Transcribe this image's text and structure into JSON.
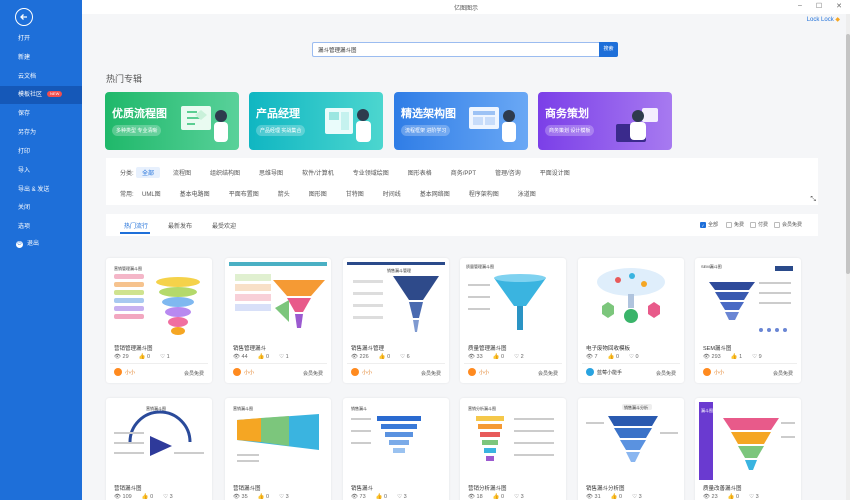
{
  "app": {
    "title": "亿图图示",
    "user": "Lock Lock"
  },
  "window": {
    "min_glyph": "–",
    "max_glyph": "☐",
    "close_glyph": "✕"
  },
  "sidebar": {
    "items": [
      {
        "label": "打开"
      },
      {
        "label": "新建"
      },
      {
        "label": "云文档"
      },
      {
        "label": "模板社区",
        "badge": "NEW",
        "active": true
      },
      {
        "label": "保存"
      },
      {
        "label": "另存为"
      },
      {
        "label": "打印"
      },
      {
        "label": "导入"
      },
      {
        "label": "导出 & 发送"
      },
      {
        "label": "关闭"
      },
      {
        "label": "选项"
      },
      {
        "label": "退出"
      }
    ]
  },
  "search": {
    "value": "漏斗管理漏斗图",
    "button": "搜索"
  },
  "section_title": "热门专辑",
  "banners": [
    {
      "title": "优质流程图",
      "subtitle": "多种类型 专业清晰"
    },
    {
      "title": "产品经理",
      "subtitle": "产品经理 实战集合"
    },
    {
      "title": "精选架构图",
      "subtitle": "流程框架 进阶学习"
    },
    {
      "title": "商务策划",
      "subtitle": "商务策划 设计模板"
    }
  ],
  "filters": {
    "category_label": "分类:",
    "categories": [
      "全部",
      "流程图",
      "组织结构图",
      "思维导图",
      "软件/计算机",
      "专业领域绘图",
      "图形表格",
      "商务/PPT",
      "管理/咨询",
      "平面设计图"
    ],
    "common_label": "常用:",
    "common": [
      "UML图",
      "基本电路图",
      "平面布置图",
      "箭头",
      "图形图",
      "甘特图",
      "时间线",
      "基本网络图",
      "程序架构图",
      "泳道图"
    ]
  },
  "tabs": [
    "热门流行",
    "最新发布",
    "最受欢迎"
  ],
  "checkboxes": [
    {
      "label": "全部",
      "checked": true
    },
    {
      "label": "免费",
      "checked": false
    },
    {
      "label": "付费",
      "checked": false
    },
    {
      "label": "会员免费",
      "checked": false
    }
  ],
  "cards": [
    {
      "title": "营销管理漏斗图",
      "views": "29",
      "likes": "0",
      "favs": "1",
      "author": "小小",
      "price": "会员免费",
      "thumb_label": "营销管理漏斗图"
    },
    {
      "title": "销售管理漏斗",
      "views": "44",
      "likes": "0",
      "favs": "1",
      "author": "小小",
      "price": "会员免费",
      "thumb_label": ""
    },
    {
      "title": "销售漏斗管理",
      "views": "226",
      "likes": "0",
      "favs": "6",
      "author": "小小",
      "price": "会员免费",
      "thumb_label": "销售漏斗管理"
    },
    {
      "title": "质量管理漏斗图",
      "views": "33",
      "likes": "0",
      "favs": "2",
      "author": "小小",
      "price": "会员免费",
      "thumb_label": "质量管理漏斗图"
    },
    {
      "title": "电子废物回收模板",
      "views": "7",
      "likes": "0",
      "favs": "0",
      "author": "蓝莓小能手",
      "price": "会员免费",
      "thumb_label": ""
    },
    {
      "title": "SEM漏斗图",
      "views": "293",
      "likes": "1",
      "favs": "9",
      "author": "小小",
      "price": "会员免费",
      "thumb_label": "SEM漏斗图"
    },
    {
      "title": "营销漏斗图",
      "views": "109",
      "likes": "0",
      "favs": "3",
      "author": "",
      "price": "",
      "thumb_label": "营销漏斗图"
    },
    {
      "title": "营销漏斗图",
      "views": "35",
      "likes": "0",
      "favs": "3",
      "author": "",
      "price": "",
      "thumb_label": "营销漏斗图"
    },
    {
      "title": "销售漏斗",
      "views": "73",
      "likes": "0",
      "favs": "3",
      "author": "",
      "price": "",
      "thumb_label": "销售漏斗"
    },
    {
      "title": "营销分析漏斗图",
      "views": "18",
      "likes": "0",
      "favs": "3",
      "author": "",
      "price": "",
      "thumb_label": "营销分析漏斗图"
    },
    {
      "title": "销售漏斗分析图",
      "views": "31",
      "likes": "0",
      "favs": "3",
      "author": "",
      "price": "",
      "thumb_label": "销售漏斗分析"
    },
    {
      "title": "质量改善漏斗图",
      "views": "23",
      "likes": "0",
      "favs": "3",
      "author": "",
      "price": "",
      "thumb_label": "漏斗图"
    }
  ],
  "colors": {
    "accent": "#1e6fd9",
    "sidebar": "#1e6fd9",
    "active": "#1558b8"
  }
}
